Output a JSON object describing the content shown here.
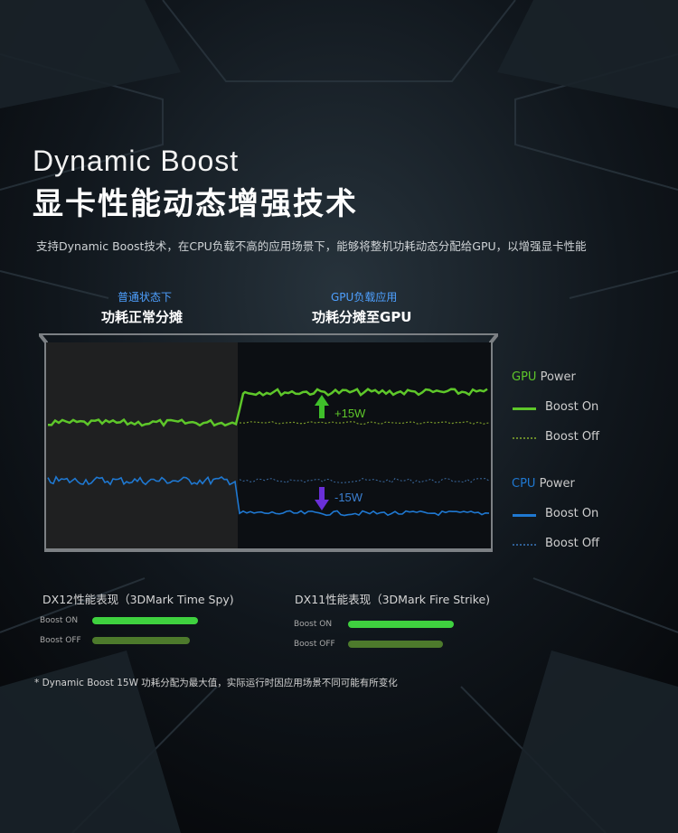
{
  "header": {
    "title_en": "Dynamic Boost",
    "title_cn": "显卡性能动态增强技术",
    "subtitle": "支持Dynamic Boost技术，在CPU负载不高的应用场景下，能够将整机功耗动态分配给GPU，以增强显卡性能"
  },
  "modes": [
    {
      "tag": "普通状态下",
      "title": "功耗正常分摊"
    },
    {
      "tag": "GPU负载应用",
      "title": "功耗分摊至GPU"
    }
  ],
  "chart": {
    "gpu_delta": "+15W",
    "cpu_delta": "-15W",
    "colors": {
      "gpu": "#5ec72a",
      "cpu": "#1f78d1",
      "panel_left": "#1e1f20",
      "panel_right": "#0d1014",
      "frame": "#7a7d80"
    }
  },
  "legend": {
    "gpu": {
      "prefix": "GPU",
      "suffix": " Power",
      "boost_on": "Boost On",
      "boost_off": "Boost Off"
    },
    "cpu": {
      "prefix": "CPU",
      "suffix": " Power",
      "boost_on": "Boost On",
      "boost_off": "Boost Off"
    }
  },
  "performance": [
    {
      "title": "DX12性能表现（3DMark Time Spy)",
      "on_label": "Boost ON",
      "off_label": "Boost OFF",
      "on_value": 1.0,
      "off_value": 0.92
    },
    {
      "title": "DX11性能表现（3DMark Fire Strike)",
      "on_label": "Boost ON",
      "off_label": "Boost OFF",
      "on_value": 1.0,
      "off_value": 0.9
    }
  ],
  "footnote": "* Dynamic Boost  15W 功耗分配为最大值，实际运行时因应用场景不同可能有所变化"
}
